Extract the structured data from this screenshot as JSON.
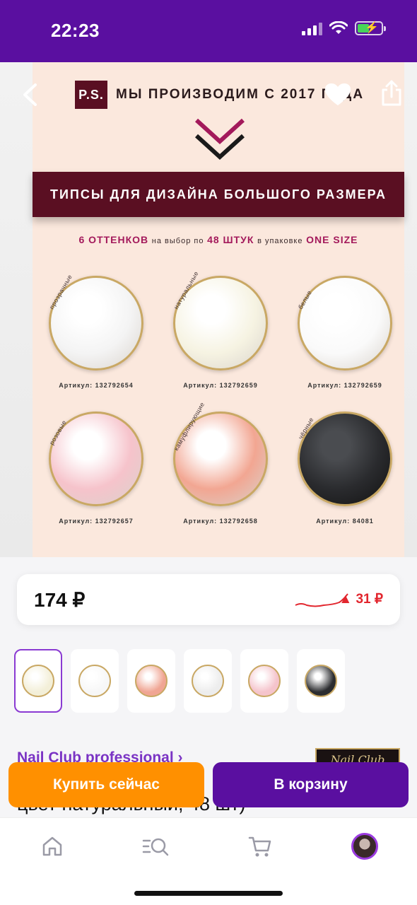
{
  "status_bar": {
    "time": "22:23"
  },
  "poster": {
    "ps_badge": "P.S.",
    "ps_text": "МЫ ПРОИЗВОДИМ С 2017 ГОДА",
    "banner": "ТИПСЫ ДЛЯ ДИЗАЙНА БОЛЬШОГО РАЗМЕРА",
    "offer": {
      "shades": "6 ОТТЕНКОВ",
      "mid1": "на выбор по",
      "count": "48 ШТУК",
      "mid2": "в упаковке",
      "size": "ONE SIZE"
    },
    "tips": [
      {
        "label": "прозрачные",
        "article": "Артикул: 132792654",
        "color": "#f4f4f4"
      },
      {
        "label": "натуральные",
        "article": "Артикул: 132792659",
        "color": "#f6f3e2"
      },
      {
        "label": "белые",
        "article": "Артикул: 132792659",
        "color": "#fafafa"
      },
      {
        "label": "розовые",
        "article": "Артикул: 132792657",
        "color": "#f6c3cb"
      },
      {
        "label": "камуфлирующие",
        "article": "Артикул: 132792658",
        "color": "#f2a692"
      },
      {
        "label": "чёрные",
        "article": "Артикул: 84081",
        "color": "#2a2b2e"
      }
    ]
  },
  "price_card": {
    "price": "174 ₽",
    "delta": "▲ 31 ₽"
  },
  "variants": [
    {
      "color": "#f3efd8",
      "selected": true
    },
    {
      "color": "#f7f7f7",
      "selected": false
    },
    {
      "color": "#f0a593",
      "selected": false
    },
    {
      "color": "#ededed",
      "selected": false
    },
    {
      "color": "#f5c4cc",
      "selected": false
    },
    {
      "color": "#2b2c2f",
      "selected": false
    }
  ],
  "brand": {
    "name": "Nail Club professional ›",
    "logo_text": "Nail Club"
  },
  "title_partial": "цвет натуральный, 48 шт)",
  "actions": {
    "buy_now": "Купить сейчас",
    "add_to_cart": "В корзину"
  },
  "colors": {
    "accent": "#5a0fa0",
    "buy": "#ff9000",
    "brand_text": "#7a33c4",
    "price_up": "#e2262e"
  }
}
